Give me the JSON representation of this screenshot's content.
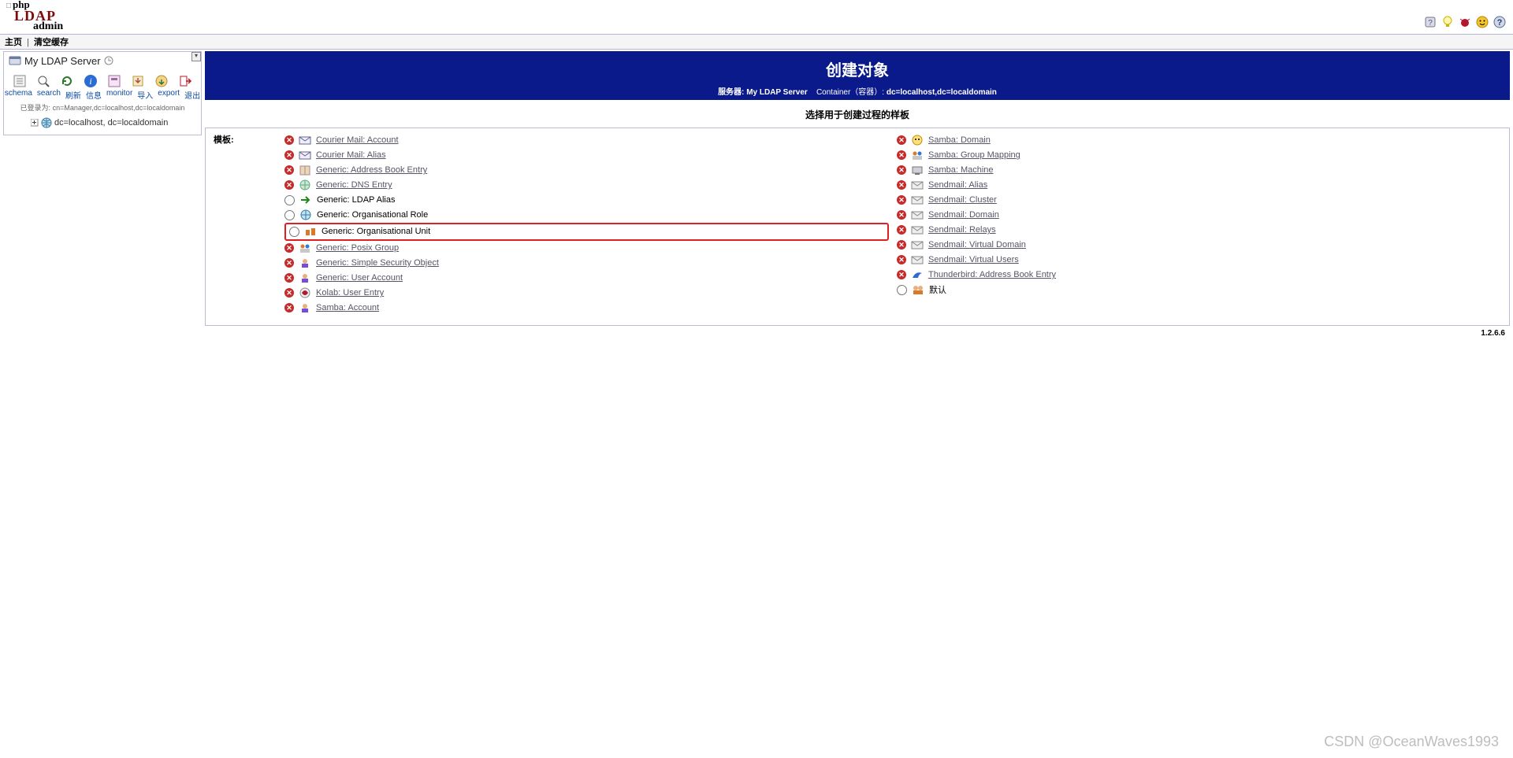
{
  "logo": {
    "l1": "php",
    "l2": "LDAP",
    "l3": "admin"
  },
  "topicons": [
    {
      "name": "request-feature-icon"
    },
    {
      "name": "lightbulb-icon"
    },
    {
      "name": "bug-icon"
    },
    {
      "name": "smiley-icon"
    },
    {
      "name": "help-icon"
    }
  ],
  "navbar": {
    "home": "主页",
    "sep": "|",
    "purge": "清空缓存"
  },
  "left": {
    "title": "My LDAP Server",
    "toolbar_links": [
      "schema",
      "search",
      "刷新",
      "信息",
      "monitor",
      "导入",
      "export",
      "退出"
    ],
    "logged_in_prefix": "已登录为:",
    "logged_in_dn": "cn=Manager,dc=localhost,dc=localdomain",
    "tree_node": "dc=localhost, dc=localdomain"
  },
  "header": {
    "title": "创建对象",
    "server_label": "服务器:",
    "server_name": "My LDAP Server",
    "container_label": "Container（容器）:",
    "container_dn": "dc=localhost,dc=localdomain"
  },
  "subtitle": "选择用于创建过程的样板",
  "panel_label": "模板:",
  "templates_left": [
    {
      "kind": "disabled",
      "icon": "mail",
      "label": "Courier Mail: Account"
    },
    {
      "kind": "disabled",
      "icon": "mail",
      "label": "Courier Mail: Alias"
    },
    {
      "kind": "disabled",
      "icon": "book",
      "label": "Generic: Address Book Entry"
    },
    {
      "kind": "disabled",
      "icon": "dns",
      "label": "Generic: DNS Entry"
    },
    {
      "kind": "radio",
      "icon": "arrow",
      "label": "Generic: LDAP Alias"
    },
    {
      "kind": "radio",
      "icon": "globe",
      "label": "Generic: Organisational Role"
    },
    {
      "kind": "radio",
      "icon": "ou",
      "label": "Generic: Organisational Unit",
      "highlight": true
    },
    {
      "kind": "disabled",
      "icon": "group",
      "label": "Generic: Posix Group"
    },
    {
      "kind": "disabled",
      "icon": "user",
      "label": "Generic: Simple Security Object"
    },
    {
      "kind": "disabled",
      "icon": "user",
      "label": "Generic: User Account"
    },
    {
      "kind": "disabled",
      "icon": "kolab",
      "label": "Kolab: User Entry"
    },
    {
      "kind": "disabled",
      "icon": "user",
      "label": "Samba: Account"
    }
  ],
  "templates_right": [
    {
      "kind": "disabled",
      "icon": "samba",
      "label": "Samba: Domain"
    },
    {
      "kind": "disabled",
      "icon": "group",
      "label": "Samba: Group Mapping"
    },
    {
      "kind": "disabled",
      "icon": "machine",
      "label": "Samba: Machine"
    },
    {
      "kind": "disabled",
      "icon": "env",
      "label": "Sendmail: Alias"
    },
    {
      "kind": "disabled",
      "icon": "env",
      "label": "Sendmail: Cluster"
    },
    {
      "kind": "disabled",
      "icon": "env",
      "label": "Sendmail: Domain"
    },
    {
      "kind": "disabled",
      "icon": "env",
      "label": "Sendmail: Relays"
    },
    {
      "kind": "disabled",
      "icon": "env",
      "label": "Sendmail: Virtual Domain"
    },
    {
      "kind": "disabled",
      "icon": "env",
      "label": "Sendmail: Virtual Users"
    },
    {
      "kind": "disabled",
      "icon": "tbird",
      "label": "Thunderbird: Address Book Entry"
    },
    {
      "kind": "radio",
      "icon": "default",
      "label": "默认",
      "plain": true
    }
  ],
  "version": "1.2.6.6",
  "watermark": "CSDN @OceanWaves1993"
}
